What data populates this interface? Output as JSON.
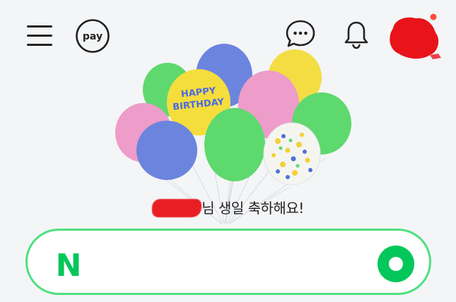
{
  "header": {
    "pay_label": "pay",
    "icons": [
      "menu-icon",
      "pay-icon",
      "chat-icon",
      "bell-icon",
      "avatar"
    ]
  },
  "greeting": {
    "suffix": "님 생일 축하해요!"
  },
  "balloon": {
    "text_line1": "HAPPY",
    "text_line2": "BIRTHDAY"
  },
  "search": {
    "logo_letter": "N",
    "value": ""
  },
  "colors": {
    "brand_green": "#03c75a",
    "search_border": "#4ee07f",
    "notification_dot": "#ff4b3a"
  }
}
